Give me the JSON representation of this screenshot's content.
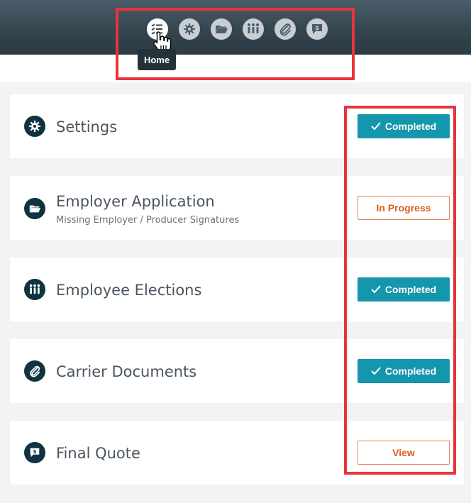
{
  "nav": {
    "icons": [
      "checklist-icon",
      "gear-icon",
      "folder-icon",
      "people-icon",
      "paperclip-icon",
      "dollar-chat-icon"
    ],
    "active": "checklist-icon",
    "tooltip": "Home"
  },
  "cards": [
    {
      "title": "Settings",
      "subtitle": "",
      "icon": "gear-icon",
      "status": "Completed",
      "status_type": "completed"
    },
    {
      "title": "Employer Application",
      "subtitle": "Missing Employer / Producer Signatures",
      "icon": "folder-icon",
      "status": "In Progress",
      "status_type": "progress"
    },
    {
      "title": "Employee Elections",
      "subtitle": "",
      "icon": "people-icon",
      "status": "Completed",
      "status_type": "completed"
    },
    {
      "title": "Carrier Documents",
      "subtitle": "",
      "icon": "paperclip-icon",
      "status": "Completed",
      "status_type": "completed"
    },
    {
      "title": "Final Quote",
      "subtitle": "",
      "icon": "dollar-chat-icon",
      "status": "View",
      "status_type": "progress"
    }
  ],
  "colors": {
    "header": "#34454f",
    "accent": "#1496ad",
    "warning": "#e05a1f",
    "highlight": "#e8333c",
    "icon_bg": "#0f3340"
  }
}
